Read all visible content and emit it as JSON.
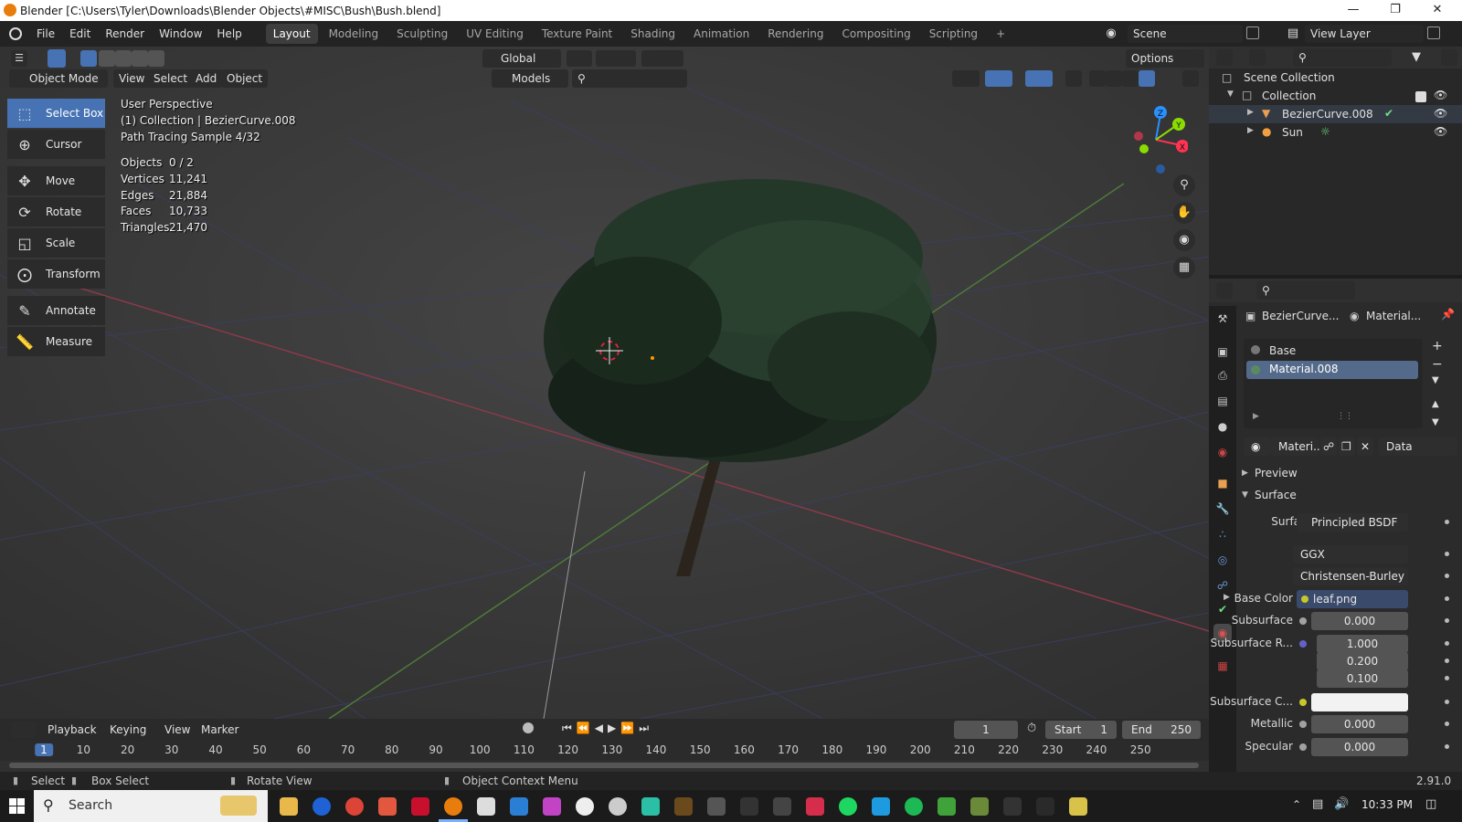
{
  "window": {
    "title": "Blender [C:\\Users\\Tyler\\Downloads\\Blender Objects\\#MISC\\Bush\\Bush.blend]"
  },
  "menu": [
    "File",
    "Edit",
    "Render",
    "Window",
    "Help"
  ],
  "workspaces": [
    "Layout",
    "Modeling",
    "Sculpting",
    "UV Editing",
    "Texture Paint",
    "Shading",
    "Animation",
    "Rendering",
    "Compositing",
    "Scripting",
    "+"
  ],
  "top_right": {
    "scene": "Scene",
    "view_layer": "View Layer"
  },
  "viewport_header": {
    "transform_orientation": "Global",
    "options": "Options",
    "mode": "Object Mode",
    "menus": [
      "View",
      "Select",
      "Add",
      "Object"
    ],
    "collection_filter": "Models"
  },
  "tools": [
    "Select Box",
    "Cursor",
    "Move",
    "Rotate",
    "Scale",
    "Transform",
    "Annotate",
    "Measure"
  ],
  "viewport_overlay": {
    "perspective": "User Perspective",
    "context": "(1) Collection | BezierCurve.008",
    "samples": "Path Tracing Sample 4/32",
    "stats": [
      {
        "label": "Objects",
        "value": "0 / 2"
      },
      {
        "label": "Vertices",
        "value": "11,241"
      },
      {
        "label": "Edges",
        "value": "21,884"
      },
      {
        "label": "Faces",
        "value": "10,733"
      },
      {
        "label": "Triangles",
        "value": "21,470"
      }
    ]
  },
  "gizmo": {
    "x": "X",
    "y": "Y",
    "z": "Z"
  },
  "outliner": {
    "root": "Scene Collection",
    "collection": "Collection",
    "items": [
      "BezierCurve.008",
      "Sun"
    ]
  },
  "properties": {
    "object_name": "BezierCurve...",
    "material_name": "Material...",
    "slots": [
      "Base",
      "Material.008"
    ],
    "selected_slot": "Material.008",
    "material_field": "Materi...",
    "link": "Data",
    "sections": {
      "preview": "Preview",
      "surface": "Surface"
    },
    "surface": "Principled BSDF",
    "distribution": "GGX",
    "subsurface_method": "Christensen-Burley",
    "base_color": {
      "label": "Base Color",
      "value": "leaf.png"
    },
    "subsurface": {
      "label": "Subsurface",
      "value": "0.000"
    },
    "subsurface_radius": {
      "label": "Subsurface R...",
      "values": [
        "1.000",
        "0.200",
        "0.100"
      ]
    },
    "subsurface_color": {
      "label": "Subsurface C..."
    },
    "metallic": {
      "label": "Metallic",
      "value": "0.000"
    },
    "specular": {
      "label": "Specular",
      "value": "0.000"
    },
    "surface_label": "Surface"
  },
  "timeline": {
    "menus": [
      "Playback",
      "Keying",
      "View",
      "Marker"
    ],
    "current_frame": "1",
    "start_label": "Start",
    "start": "1",
    "end_label": "End",
    "end": "250",
    "ruler": [
      "1",
      "10",
      "20",
      "30",
      "40",
      "50",
      "60",
      "70",
      "80",
      "90",
      "100",
      "110",
      "120",
      "130",
      "140",
      "150",
      "160",
      "170",
      "180",
      "190",
      "200",
      "210",
      "220",
      "230",
      "240",
      "250"
    ]
  },
  "statusbar": {
    "select": "Select",
    "box_select": "Box Select",
    "rotate_view": "Rotate View",
    "context_menu": "Object Context Menu",
    "version": "2.91.0"
  },
  "taskbar": {
    "search": "Search",
    "time": "10:33 PM"
  },
  "colors": {
    "accent": "#4772b3",
    "axis_x": "#ff3352",
    "axis_y": "#8bdc00",
    "axis_z": "#2890ff",
    "viewport_bg": "#3a3a3a"
  }
}
